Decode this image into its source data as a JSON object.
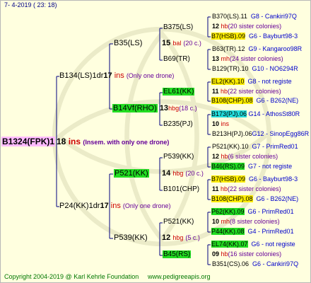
{
  "header": {
    "date": "7-   4-2019  (  23:  18)"
  },
  "footer": {
    "copyright": "Copyright 2004-2019 @ Karl Kehrle Foundation",
    "site": "www.pedigreeapis.org"
  },
  "colors": {
    "background": "#ffffdf",
    "green": "#22dd22",
    "yellow": "#ffee00",
    "cyan": "#22dddd",
    "pink": "#ffbbff",
    "line": "#000080"
  },
  "root": {
    "id": "B1324(FPK)1",
    "number": "18",
    "ins": "ins",
    "note": "(Insem. with only one drone)"
  },
  "gen1": [
    {
      "id": "B134(LS)1dr",
      "number": "17",
      "ins": "ins",
      "note": "(Only one drone)"
    },
    {
      "id": "P24(KK)1dr",
      "number": "17",
      "ins": "ins",
      "note": "(Only one drone)"
    }
  ],
  "gen2": [
    {
      "id": "B35(LS)"
    },
    {
      "id": "B14Vf(RHO)",
      "number": "13",
      "ins": "hbg",
      "note": "(18 c.)"
    },
    {
      "id": "P521(KK)",
      "number": "14",
      "ins": "hbg",
      "note": "(20 c.)"
    },
    {
      "id": "P539(KK)",
      "number": "12",
      "ins": "hbg",
      "note": "(5 c.)"
    }
  ],
  "gen2b": [
    {
      "id": "B35(LS)",
      "number": "15",
      "ins": "bal",
      "note": "(20 c.)"
    }
  ],
  "gen3": [
    {
      "id": "B375(LS)"
    },
    {
      "id": "B69(TR)"
    },
    {
      "id": "EL61(KK)"
    },
    {
      "id": "B235(PJ)"
    },
    {
      "id": "P539(KK)"
    },
    {
      "id": "B101(CHP)"
    },
    {
      "id": "P521(KK)"
    },
    {
      "id": "B45(RS)"
    }
  ],
  "gen4": [
    {
      "id": "B370(LS).11",
      "note": "G8 - Cankiri97Q"
    },
    {
      "id": "12",
      "ins": "hb",
      "note": "(20 sister colonies)"
    },
    {
      "id": "B7(HSB).09",
      "note": "G6 - Bayburt98-3"
    },
    {
      "id": "B63(TR).12",
      "note": "G9 - Kangaroo98R"
    },
    {
      "id": "13",
      "ins": "mh",
      "note": "(24 sister colonies)"
    },
    {
      "id": "B129(TR).10",
      "note": "G10 - NO6294R"
    },
    {
      "id": "EL2(KK).10",
      "note": "G8 - not registe"
    },
    {
      "id": "11",
      "ins": "hb",
      "note": "(22 sister colonies)"
    },
    {
      "id": "B108(CHP).08",
      "note": "G6 - B262(NE)"
    },
    {
      "id": "B173(PJ).06",
      "note": "G14 - AthosSt80R"
    },
    {
      "id": "10",
      "ins": "ins",
      "note": ""
    },
    {
      "id": "B213H(PJ).06",
      "note": "G12 - SinopEgg86R"
    },
    {
      "id": "P521(KK).10",
      "note": "G7 - PrimRed01"
    },
    {
      "id": "12",
      "ins": "hb",
      "note": "(6 sister colonies)"
    },
    {
      "id": "B46(RS).09",
      "note": "G7 - not registe"
    },
    {
      "id": "B7(HSB).09",
      "note": "G6 - Bayburt98-3"
    },
    {
      "id": "11",
      "ins": "hb",
      "note": "(22 sister colonies)"
    },
    {
      "id": "B108(CHP).08",
      "note": "G6 - B262(NE)"
    },
    {
      "id": "P62(KK).09",
      "note": "G6 - PrimRed01"
    },
    {
      "id": "10",
      "ins": "mh",
      "note": "(8 sister colonies)"
    },
    {
      "id": "P44(KK).08",
      "note": "G4 - PrimRed01"
    },
    {
      "id": "EL74(KK).07",
      "note": "G6 - not registe"
    },
    {
      "id": "09",
      "ins": "hb",
      "note": "(16 sister colonies)"
    },
    {
      "id": "B351(CS).06",
      "note": "G6 - Cankiri97Q"
    }
  ]
}
